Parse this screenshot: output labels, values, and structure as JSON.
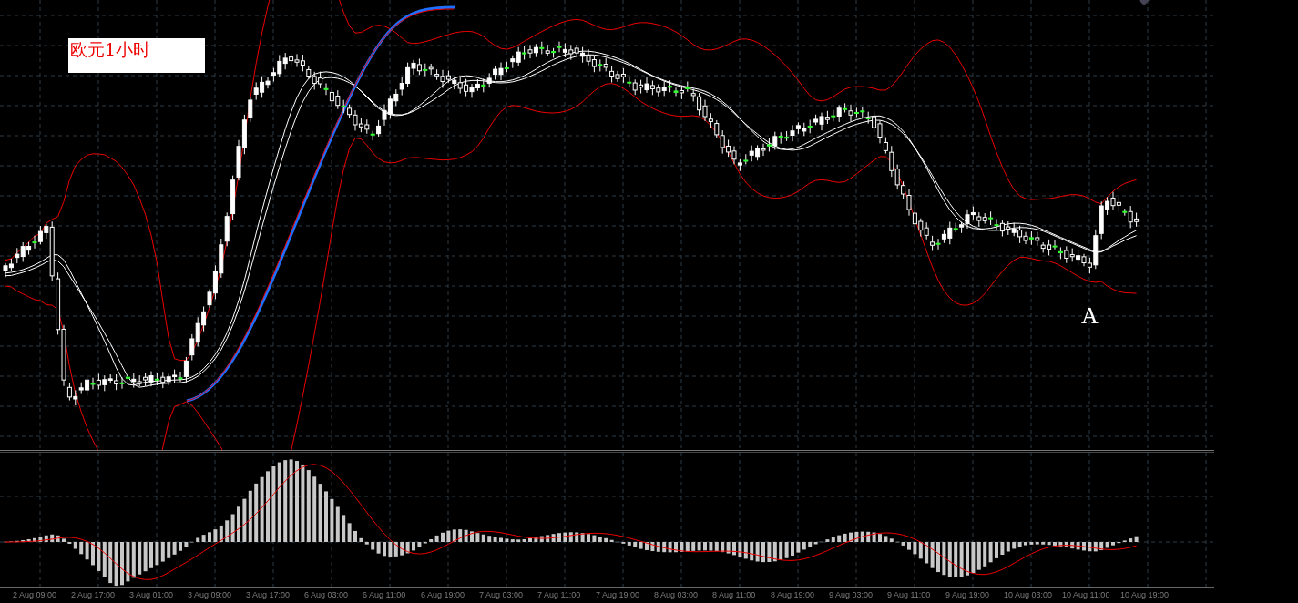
{
  "chart": {
    "title": "欧元1小时",
    "marker": "A"
  },
  "time_axis": {
    "labels": [
      "2 Aug 09:00",
      "2 Aug 17:00",
      "3 Aug 01:00",
      "3 Aug 09:00",
      "3 Aug 17:00",
      "6 Aug 03:00",
      "6 Aug 11:00",
      "6 Aug 19:00",
      "7 Aug 03:00",
      "7 Aug 11:00",
      "7 Aug 19:00",
      "8 Aug 03:00",
      "8 Aug 11:00",
      "8 Aug 19:00",
      "9 Aug 03:00",
      "9 Aug 11:00",
      "9 Aug 19:00",
      "10 Aug 03:00",
      "10 Aug 11:00",
      "10 Aug 19:00"
    ]
  }
}
